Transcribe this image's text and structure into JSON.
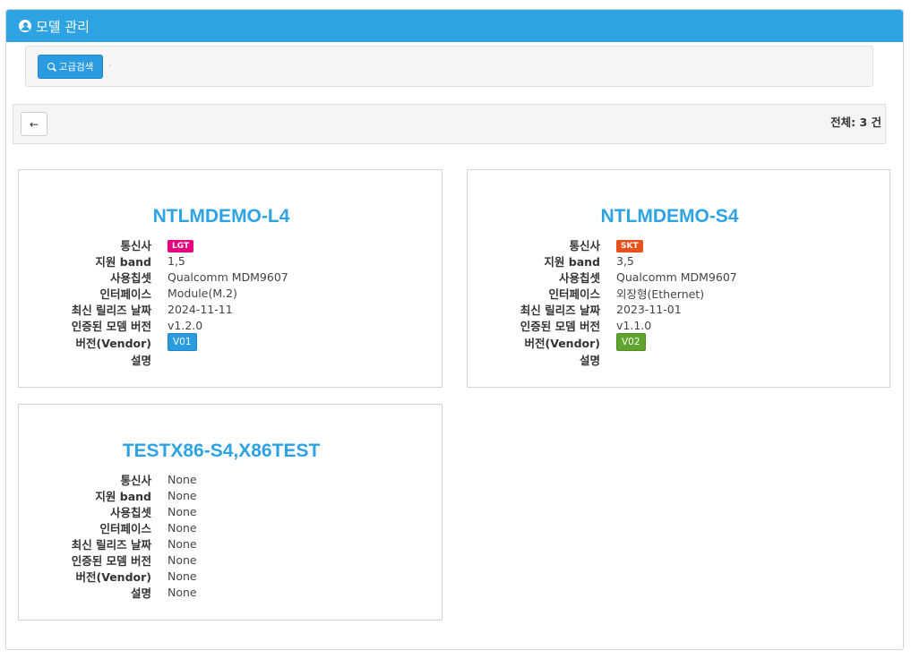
{
  "header": {
    "title": "모델 관리"
  },
  "search": {
    "advanced_label": "고급검색"
  },
  "toolbar": {
    "back_icon": "arrow-left-icon",
    "total": "전체: 3 건"
  },
  "field_labels": {
    "carrier": "통신사",
    "band": "지원 band",
    "chipset": "사용칩셋",
    "interface": "인터페이스",
    "release_date": "최신 릴리즈 날짜",
    "certified_version": "인증된 모뎀 버전",
    "vendor_version": "버전(Vendor)",
    "description": "설명"
  },
  "cards": [
    {
      "title": "NTLMDEMO-L4",
      "carrier": "LGT",
      "carrier_color": "#e6007e",
      "band": "1,5",
      "chipset": "Qualcomm MDM9607",
      "interface": "Module(M.2)",
      "release_date": "2024-11-11",
      "certified_version": "v1.2.0",
      "vendor_version": "V01",
      "vendor_color": "#2a9be0",
      "description": ""
    },
    {
      "title": "NTLMDEMO-S4",
      "carrier": "SKT",
      "carrier_color": "#e8501c",
      "band": "3,5",
      "chipset": "Qualcomm MDM9607",
      "interface": "외장형(Ethernet)",
      "release_date": "2023-11-01",
      "certified_version": "v1.1.0",
      "vendor_version": "V02",
      "vendor_color": "#5fa52d",
      "description": ""
    },
    {
      "title": "TESTX86-S4,X86TEST",
      "carrier": "None",
      "band": "None",
      "chipset": "None",
      "interface": "None",
      "release_date": "None",
      "certified_version": "None",
      "vendor_version": "None",
      "description": "None"
    }
  ]
}
